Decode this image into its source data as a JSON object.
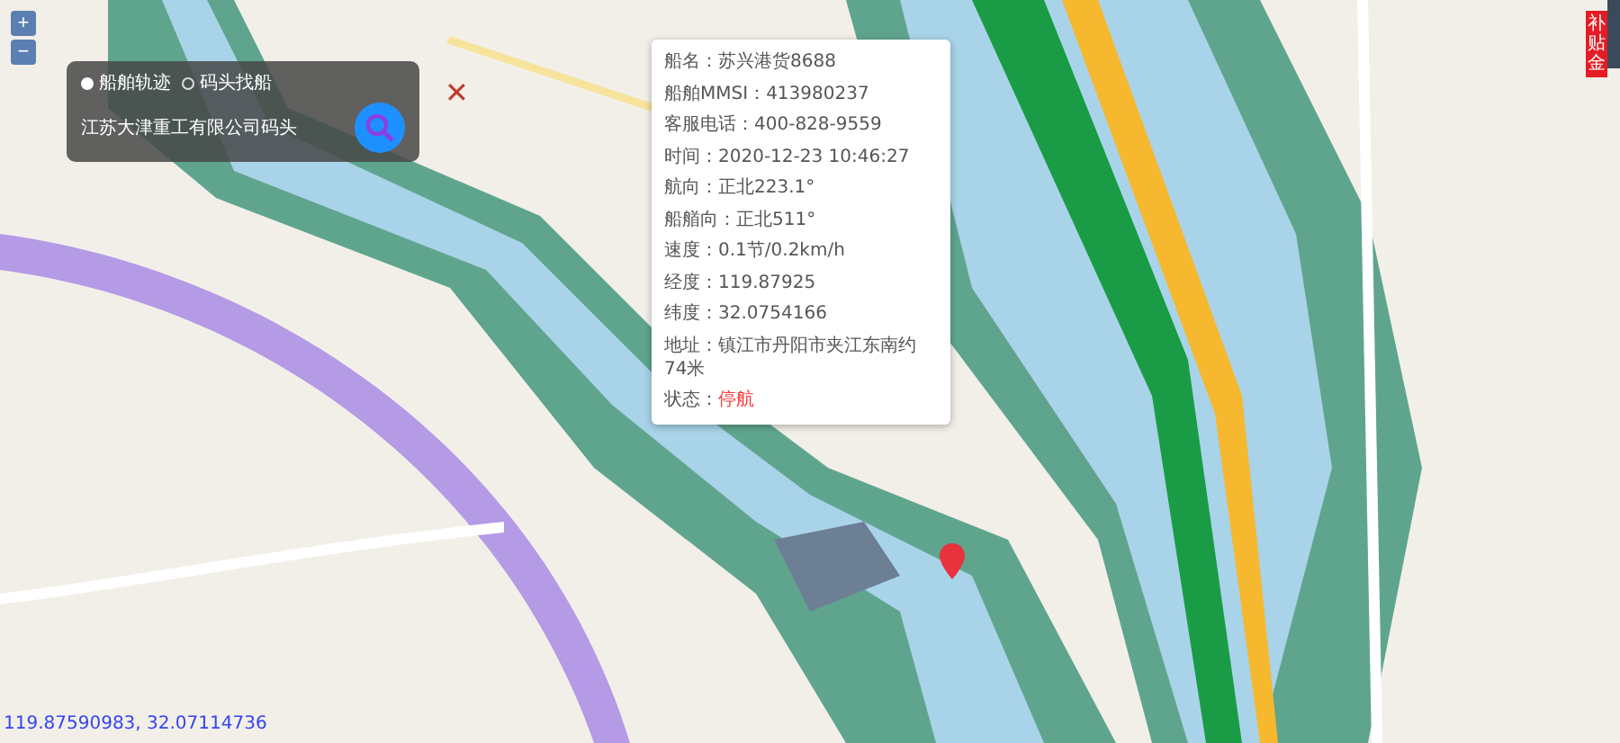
{
  "zoom_controls": [
    "+",
    "−"
  ],
  "search_panel": {
    "modes": [
      {
        "label": "船舶轨迹",
        "selected": true
      },
      {
        "label": "码头找船",
        "selected": false
      }
    ],
    "value": "江苏大津重工有限公司码头"
  },
  "close_icon": "✕",
  "popup": {
    "fields": [
      {
        "label": "船名：",
        "value": "苏兴港货8688",
        "color": "#555555"
      },
      {
        "label": "船舶MMSI：",
        "value": "413980237",
        "color": "#555555"
      },
      {
        "label": "客服电话：",
        "value": "400-828-9559",
        "color": "#555555"
      },
      {
        "label": "时间：",
        "value": "2020-12-23 10:46:27",
        "color": "#555555"
      },
      {
        "label": "航向：",
        "value": "正北223.1°",
        "color": "#555555"
      },
      {
        "label": "船艏向：",
        "value": "正北511°",
        "color": "#555555"
      },
      {
        "label": "速度：",
        "value": "0.1节/0.2km/h",
        "color": "#555555"
      },
      {
        "label": "经度：",
        "value": "119.87925",
        "color": "#555555"
      },
      {
        "label": "纬度：",
        "value": "32.0754166",
        "color": "#555555"
      },
      {
        "label": "地址：",
        "value": "镇江市丹阳市夹江东南约74米",
        "color": "#555555"
      },
      {
        "label": "状态：",
        "value": "停航",
        "color": "#ff3333"
      }
    ]
  },
  "side_badge": "补贴金",
  "coordinates": "119.87590983, 32.07114736"
}
